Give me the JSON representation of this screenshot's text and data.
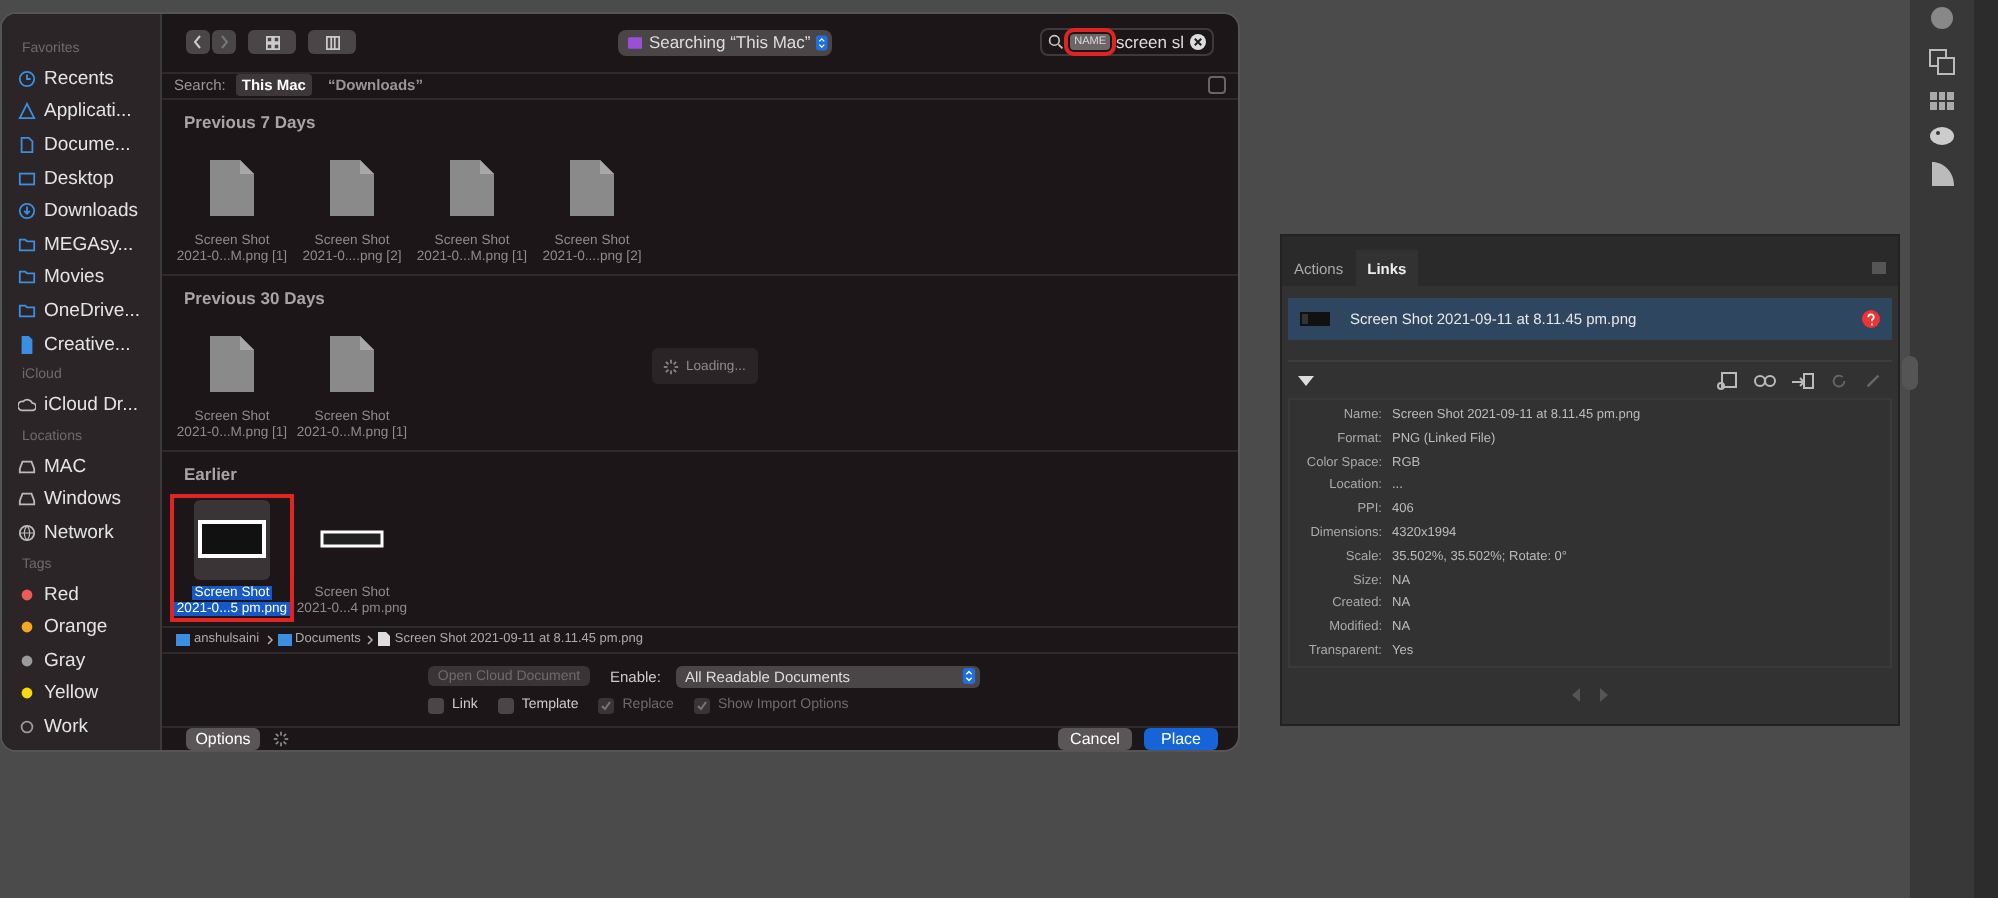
{
  "sidebar": {
    "sections": [
      {
        "heading": "Favorites",
        "items": [
          {
            "label": "Recents",
            "kind": "clock"
          },
          {
            "label": "Applicati...",
            "kind": "apps"
          },
          {
            "label": "Docume...",
            "kind": "doc"
          },
          {
            "label": "Desktop",
            "kind": "desktop"
          },
          {
            "label": "Downloads",
            "kind": "download"
          },
          {
            "label": "MEGAsy...",
            "kind": "folder"
          },
          {
            "label": "Movies",
            "kind": "folder"
          },
          {
            "label": "OneDrive...",
            "kind": "folder"
          },
          {
            "label": "Creative...",
            "kind": "file"
          }
        ]
      },
      {
        "heading": "iCloud",
        "items": [
          {
            "label": "iCloud Dr...",
            "kind": "cloud"
          }
        ]
      },
      {
        "heading": "Locations",
        "items": [
          {
            "label": "MAC",
            "kind": "disk"
          },
          {
            "label": "Windows",
            "kind": "disk"
          },
          {
            "label": "Network",
            "kind": "network"
          }
        ]
      },
      {
        "heading": "Tags",
        "items": [
          {
            "label": "Red",
            "kind": "tag",
            "color": "#ec5b56"
          },
          {
            "label": "Orange",
            "kind": "tag",
            "color": "#f5a623"
          },
          {
            "label": "Gray",
            "kind": "tag",
            "color": "#9b9b9b"
          },
          {
            "label": "Yellow",
            "kind": "tag",
            "color": "#f8d90f"
          },
          {
            "label": "Work",
            "kind": "tagempty"
          }
        ]
      }
    ]
  },
  "toolbar": {
    "location": "Searching “This Mac”",
    "search_token": "NAME",
    "token_highlighted": true,
    "search_value": "screen sl"
  },
  "scope": {
    "label": "Search:",
    "options": [
      {
        "label": "This Mac",
        "selected": true
      },
      {
        "label": "“Downloads”",
        "selected": false
      }
    ]
  },
  "groups": [
    {
      "title": "Previous 7 Days",
      "files": [
        {
          "name": "Screen Shot",
          "detail": "2021-0...M.png [1]",
          "kind": "doc",
          "selected": false
        },
        {
          "name": "Screen Shot",
          "detail": "2021-0....png [2]",
          "kind": "doc",
          "selected": false
        },
        {
          "name": "Screen Shot",
          "detail": "2021-0...M.png [1]",
          "kind": "doc",
          "selected": false
        },
        {
          "name": "Screen Shot",
          "detail": "2021-0....png [2]",
          "kind": "doc",
          "selected": false
        }
      ]
    },
    {
      "title": "Previous 30 Days",
      "files": [
        {
          "name": "Screen Shot",
          "detail": "2021-0...M.png [1]",
          "kind": "doc",
          "selected": false
        },
        {
          "name": "Screen Shot",
          "detail": "2021-0...M.png [1]",
          "kind": "doc",
          "selected": false
        }
      ]
    },
    {
      "title": "Earlier",
      "files": [
        {
          "name": "Screen Shot",
          "detail": "2021-0...5 pm.png",
          "kind": "image",
          "selected": true
        },
        {
          "name": "Screen Shot",
          "detail": "2021-0...4 pm.png",
          "kind": "wide",
          "selected": false
        }
      ]
    }
  ],
  "loading": "Loading...",
  "path": [
    {
      "label": "anshulsaini",
      "kind": "folder"
    },
    {
      "label": "Documents",
      "kind": "folder"
    },
    {
      "label": "Screen Shot 2021-09-11 at 8.11.45 pm.png",
      "kind": "file"
    }
  ],
  "open_cloud": {
    "label": "Open Cloud Document",
    "disabled": true
  },
  "enable": {
    "label": "Enable:",
    "value": "All Readable Documents"
  },
  "checkboxes": [
    {
      "label": "Link",
      "checked": false,
      "disabled": false
    },
    {
      "label": "Template",
      "checked": false,
      "disabled": false
    },
    {
      "label": "Replace",
      "checked": true,
      "disabled": true
    },
    {
      "label": "Show Import Options",
      "checked": true,
      "disabled": true
    }
  ],
  "options_button": "Options",
  "buttons": [
    {
      "label": "Cancel",
      "kind": "secondary"
    },
    {
      "label": "Place",
      "kind": "primary"
    }
  ],
  "links_panel": {
    "tabs": [
      {
        "label": "Actions",
        "selected": false
      },
      {
        "label": "Links",
        "selected": true
      }
    ],
    "link": {
      "name": "Screen Shot 2021-09-11 at 8.11.45 pm.png",
      "missing": true
    },
    "info": [
      {
        "label": "Name:",
        "value": "Screen Shot 2021-09-11 at 8.11.45 pm.png"
      },
      {
        "label": "Format:",
        "value": "PNG (Linked File)"
      },
      {
        "label": "Color Space:",
        "value": "RGB"
      },
      {
        "label": "Location:",
        "value": "..."
      },
      {
        "label": "PPI:",
        "value": "406"
      },
      {
        "label": "Dimensions:",
        "value": "4320x1994"
      },
      {
        "label": "Scale:",
        "value": "35.502%, 35.502%; Rotate: 0°"
      },
      {
        "label": "Size:",
        "value": "NA"
      },
      {
        "label": "Created:",
        "value": "NA"
      },
      {
        "label": "Modified:",
        "value": "NA"
      },
      {
        "label": "Transparent:",
        "value": "Yes"
      }
    ]
  }
}
